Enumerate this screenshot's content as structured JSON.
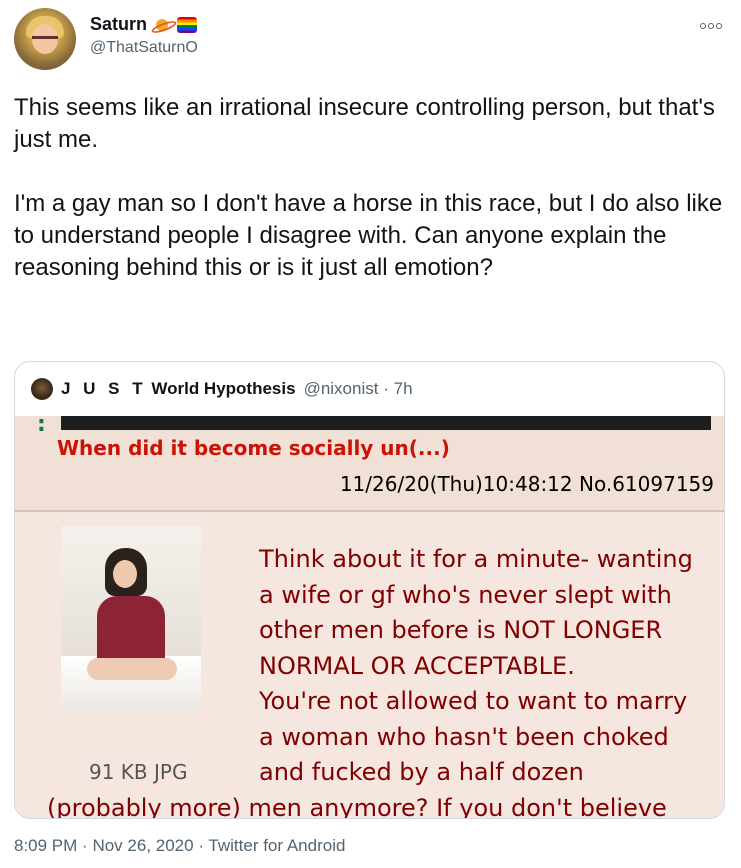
{
  "author": {
    "display_name": "Saturn",
    "name_icons": [
      "ringed-planet-icon",
      "rainbow-flag-icon"
    ],
    "handle": "@ThatSaturnO"
  },
  "tweet": {
    "paragraphs": [
      "This seems like an irrational insecure controlling person, but that's just me.",
      "I'm a gay man so I don't have a horse in this race, but I do also like to understand people I disagree with. Can anyone explain the reasoning behind this or is it just all emotion?"
    ]
  },
  "quoted": {
    "name_spaced": "J U S T",
    "name_rest": "World Hypothesis",
    "handle": "@nixonist",
    "separator": "·",
    "age": "7h",
    "media": {
      "greentext_prefix": ":",
      "subject": "When did it become socially un(...)",
      "post_info": "11/26/20(Thu)10:48:12 No.61097159",
      "file_info": "91 KB JPG",
      "body_lines": [
        "Think about it for a minute- wanting",
        "a wife or gf who's never slept with",
        "other men before is NOT LONGER",
        "NORMAL OR ACCEPTABLE.",
        "You're not allowed to want to marry",
        "a woman who hasn't been choked",
        "and fucked by a half dozen",
        "(probably more) men anymore? If you don't believe"
      ],
      "colors": {
        "background": "#f0e0d6",
        "subject": "#cc1105",
        "body_text": "#800000"
      }
    }
  },
  "footer": {
    "time": "8:09 PM",
    "date": "Nov 26, 2020",
    "source": "Twitter for Android",
    "separator": "·"
  },
  "colors": {
    "text_primary": "#0f1419",
    "text_secondary": "#536471",
    "border": "#cfd9de"
  }
}
